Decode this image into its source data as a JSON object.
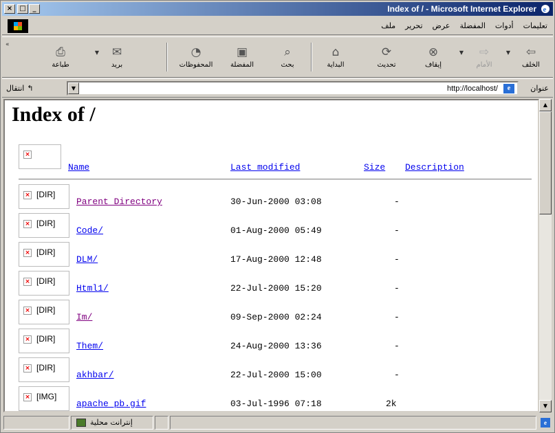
{
  "window": {
    "title": "Index of / - Microsoft Internet Explorer",
    "controls": {
      "close": "×",
      "maximize": "□",
      "minimize": "_"
    }
  },
  "menu": {
    "items": [
      "ملف",
      "تحرير",
      "عرض",
      "المفضلة",
      "أدوات",
      "تعليمات"
    ]
  },
  "toolbar": {
    "back": "الخلف",
    "forward": "الأمام",
    "stop": "إيقاف",
    "refresh": "تحديث",
    "home": "البداية",
    "search": "بحث",
    "favorites": "المفضلة",
    "history": "المحفوظات",
    "mail": "بريد",
    "print": "طباعة"
  },
  "address": {
    "label": "عنوان",
    "url": "http://localhost/",
    "go": "انتقال"
  },
  "page": {
    "title": "Index of /",
    "columns": {
      "name": "Name",
      "modified": "Last modified",
      "size": "Size",
      "description": "Description"
    },
    "rows": [
      {
        "alt": "[DIR]",
        "name": "Parent Directory",
        "date": "30-Jun-2000 03:08",
        "size": "-",
        "visited": true
      },
      {
        "alt": "[DIR]",
        "name": "Code/",
        "date": "01-Aug-2000 05:49",
        "size": "-",
        "visited": false
      },
      {
        "alt": "[DIR]",
        "name": "DLM/",
        "date": "17-Aug-2000 12:48",
        "size": "-",
        "visited": false
      },
      {
        "alt": "[DIR]",
        "name": "Html1/",
        "date": "22-Jul-2000 15:20",
        "size": "-",
        "visited": false
      },
      {
        "alt": "[DIR]",
        "name": "Im/",
        "date": "09-Sep-2000 02:24",
        "size": "-",
        "visited": true
      },
      {
        "alt": "[DIR]",
        "name": "Them/",
        "date": "24-Aug-2000 13:36",
        "size": "-",
        "visited": false
      },
      {
        "alt": "[DIR]",
        "name": "akhbar/",
        "date": "22-Jul-2000 15:00",
        "size": "-",
        "visited": false
      },
      {
        "alt": "[IMG]",
        "name": "apache_pb.gif",
        "date": "03-Jul-1996 07:18",
        "size": "2k",
        "visited": false
      }
    ]
  },
  "status": {
    "zone": "إنترانت محلية"
  },
  "colors": {
    "link": "#0000ee",
    "visited": "#800080",
    "titlebar_start": "#0a246a",
    "titlebar_end": "#a6caf0"
  }
}
